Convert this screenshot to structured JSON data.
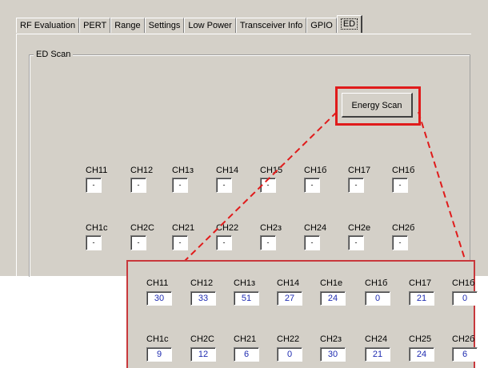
{
  "tabs": [
    "RF Evaluation",
    "PERT",
    "Range",
    "Settings",
    "Low Power",
    "Transceiver Info",
    "GPIO",
    "ED"
  ],
  "active_tab": "ED",
  "group_title": "ED Scan",
  "scan_button": "Energy Scan",
  "highlight_color": "#e01b1b",
  "channel_row1": [
    {
      "label": "CH11",
      "value": "-"
    },
    {
      "label": "CH12",
      "value": "-"
    },
    {
      "label": "CH1з",
      "value": "-"
    },
    {
      "label": "CH14",
      "value": "-"
    },
    {
      "label": "CH15",
      "value": "-"
    },
    {
      "label": "CH1б",
      "value": "-"
    },
    {
      "label": "CH17",
      "value": "-"
    },
    {
      "label": "CH1б",
      "value": "-"
    }
  ],
  "channel_row2": [
    {
      "label": "CH1с",
      "value": "-"
    },
    {
      "label": "CH2C",
      "value": "-"
    },
    {
      "label": "CH21",
      "value": "-"
    },
    {
      "label": "CH22",
      "value": "-"
    },
    {
      "label": "CH2з",
      "value": "-"
    },
    {
      "label": "CH24",
      "value": "-"
    },
    {
      "label": "CH2е",
      "value": "-"
    },
    {
      "label": "CH2б",
      "value": "-"
    }
  ],
  "zoom_row1": [
    {
      "label": "CH11",
      "value": "30"
    },
    {
      "label": "CH12",
      "value": "33"
    },
    {
      "label": "CH1з",
      "value": "51"
    },
    {
      "label": "CH14",
      "value": "27"
    },
    {
      "label": "CH1е",
      "value": "24"
    },
    {
      "label": "CH1б",
      "value": "0"
    },
    {
      "label": "CH17",
      "value": "21"
    },
    {
      "label": "CH1б",
      "value": "0"
    }
  ],
  "zoom_row2": [
    {
      "label": "CH1с",
      "value": "9"
    },
    {
      "label": "CH2C",
      "value": "12"
    },
    {
      "label": "CH21",
      "value": "6"
    },
    {
      "label": "CH22",
      "value": "0"
    },
    {
      "label": "CH2з",
      "value": "30"
    },
    {
      "label": "CH24",
      "value": "21"
    },
    {
      "label": "CH25",
      "value": "24"
    },
    {
      "label": "CH2б",
      "value": "6"
    }
  ]
}
